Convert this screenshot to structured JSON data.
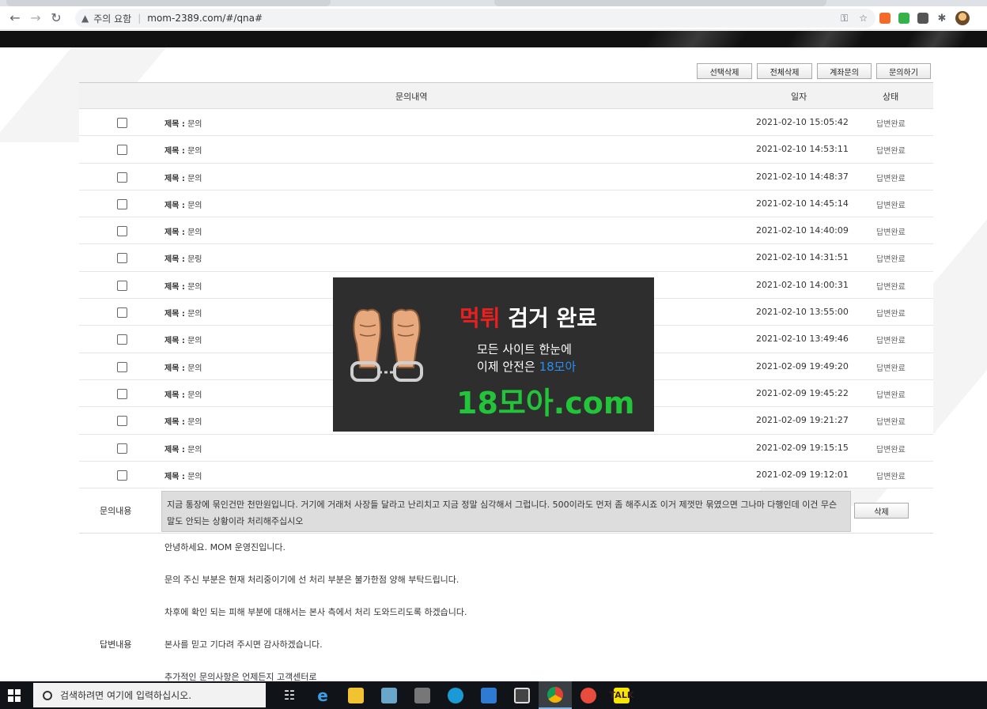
{
  "browser": {
    "security_warning": "주의 요함",
    "url": "mom-2389.com/#/qna#"
  },
  "actions": {
    "select_delete": "선택삭제",
    "delete_all": "전체삭제",
    "account_inquiry": "계좌문의",
    "inquire": "문의하기"
  },
  "table": {
    "headers": {
      "content": "문의내역",
      "date": "일자",
      "status": "상태"
    },
    "rows": [
      {
        "label": "제목 :",
        "title": "문의",
        "date": "2021-02-10 15:05:42",
        "status": "답변완료"
      },
      {
        "label": "제목 :",
        "title": "문의",
        "date": "2021-02-10 14:53:11",
        "status": "답변완료"
      },
      {
        "label": "제목 :",
        "title": "문의",
        "date": "2021-02-10 14:48:37",
        "status": "답변완료"
      },
      {
        "label": "제목 :",
        "title": "문의",
        "date": "2021-02-10 14:45:14",
        "status": "답변완료"
      },
      {
        "label": "제목 :",
        "title": "문의",
        "date": "2021-02-10 14:40:09",
        "status": "답변완료"
      },
      {
        "label": "제목 :",
        "title": "문링",
        "date": "2021-02-10 14:31:51",
        "status": "답변완료"
      },
      {
        "label": "제목 :",
        "title": "문의",
        "date": "2021-02-10 14:00:31",
        "status": "답변완료"
      },
      {
        "label": "제목 :",
        "title": "문의",
        "date": "2021-02-10 13:55:00",
        "status": "답변완료"
      },
      {
        "label": "제목 :",
        "title": "문의",
        "date": "2021-02-10 13:49:46",
        "status": "답변완료"
      },
      {
        "label": "제목 :",
        "title": "문의",
        "date": "2021-02-09 19:49:20",
        "status": "답변완료"
      },
      {
        "label": "제목 :",
        "title": "문의",
        "date": "2021-02-09 19:45:22",
        "status": "답변완료"
      },
      {
        "label": "제목 :",
        "title": "문의",
        "date": "2021-02-09 19:21:27",
        "status": "답변완료"
      },
      {
        "label": "제목 :",
        "title": "문의",
        "date": "2021-02-09 19:15:15",
        "status": "답변완료"
      },
      {
        "label": "제목 :",
        "title": "문의",
        "date": "2021-02-09 19:12:01",
        "status": "답변완료"
      }
    ]
  },
  "inquiry": {
    "label": "문의내용",
    "text": "지금 통장에 묶인건만 천만원입니다. 거기에 거래처 사장들 달라고 난리치고 지금 정말 심각해서 그럽니다. 500이라도 먼저 좀 해주시죠 이거 제껏만 묶였으면 그나마 다행인데 이건 무슨 말도 안되는 상황이라 처리해주십시오",
    "delete_label": "삭제"
  },
  "answer": {
    "label": "답변내용",
    "lines": [
      "안녕하세요. MOM 운영진입니다.",
      "문의 주신 부분은 현재 처리중이기에 선 처리 부분은 불가한점 양해 부탁드립니다.",
      "차후에 확인 되는 피해 부분에 대해서는 본사 측에서 처리 도와드리도록 하겠습니다.",
      "본사를 믿고 기다려 주시면 감사하겠습니다.",
      "추가적인 문의사항은 언제든지 고객센터로"
    ]
  },
  "ad": {
    "headline_red": "먹튀",
    "headline_white": "검거 완료",
    "line1": "모든 사이트 한눈에",
    "line2_prefix": "이제 안전은",
    "line2_brand": "18모아",
    "domain": "18모아.com",
    "colors": {
      "red": "#e8201f",
      "blue": "#2a8ef0",
      "green": "#22c43a"
    }
  },
  "taskbar": {
    "search_placeholder": "검색하려면 여기에 입력하십시오."
  }
}
